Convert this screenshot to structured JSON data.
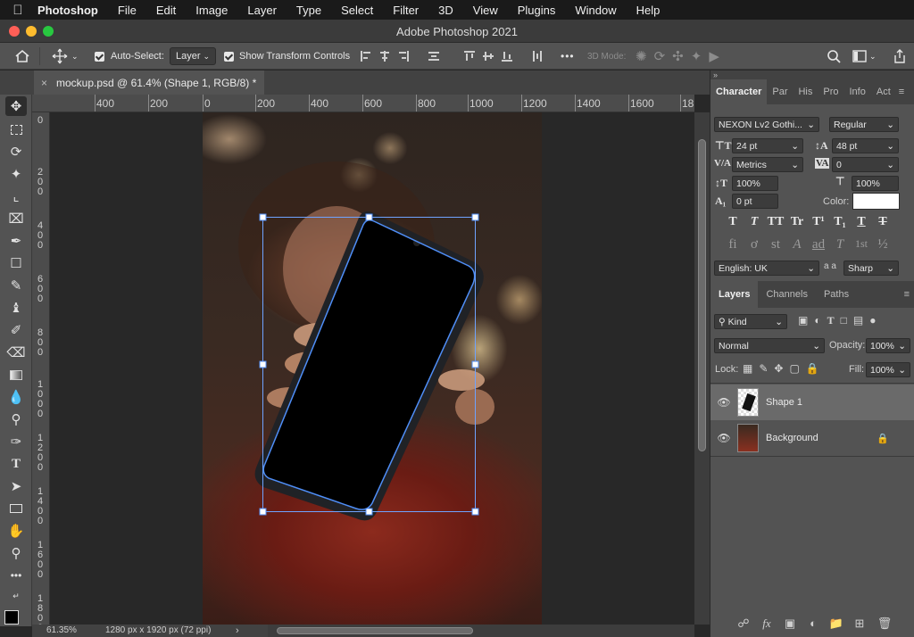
{
  "menubar": {
    "items": [
      "Photoshop",
      "File",
      "Edit",
      "Image",
      "Layer",
      "Type",
      "Select",
      "Filter",
      "3D",
      "View",
      "Plugins",
      "Window",
      "Help"
    ]
  },
  "window": {
    "title": "Adobe Photoshop 2021"
  },
  "options": {
    "auto_select_label": "Auto-Select:",
    "auto_select_target": "Layer",
    "show_transform_label": "Show Transform Controls",
    "mode_3d_label": "3D Mode:",
    "more": "•••"
  },
  "document": {
    "tab_title": "mockup.psd @ 61.4% (Shape 1, RGB/8) *"
  },
  "ruler": {
    "top_labels": [
      "400",
      "200",
      "0",
      "200",
      "400",
      "600",
      "800",
      "1000",
      "1200",
      "1400",
      "1600",
      "18"
    ],
    "left_labels": [
      "0",
      "2\n0\n0",
      "4\n0\n0",
      "6\n0\n0",
      "8\n0\n0",
      "1\n0\n0\n0",
      "1\n2\n0\n0",
      "1\n4\n0\n0",
      "1\n6\n0\n0",
      "1\n8\n0\n0"
    ]
  },
  "status": {
    "zoom": "61.35%",
    "doc_size": "1280 px x 1920 px (72 ppi)"
  },
  "character_panel": {
    "tabs": [
      "Character",
      "Par",
      "His",
      "Pro",
      "Info",
      "Act"
    ],
    "font_family": "NEXON Lv2 Gothi...",
    "font_style": "Regular",
    "font_size": "24 pt",
    "leading": "48 pt",
    "kerning": "Metrics",
    "tracking": "0",
    "vertical_scale": "100%",
    "horizontal_scale": "100%",
    "baseline_shift": "0 pt",
    "color_label": "Color:",
    "color_value": "#ffffff",
    "language": "English: UK",
    "antialias": "Sharp",
    "aa_label": "a a",
    "style_buttons": [
      "T",
      "T",
      "TT",
      "Tr",
      "T¹",
      "T₁",
      "T",
      "T"
    ],
    "opentype_buttons": [
      "fi",
      "ơ",
      "st",
      "A",
      "ad",
      "T",
      "1st",
      "½"
    ]
  },
  "layers_panel": {
    "tabs": [
      "Layers",
      "Channels",
      "Paths"
    ],
    "filter_kind": "Kind",
    "blend_mode": "Normal",
    "opacity_label": "Opacity:",
    "opacity_value": "100%",
    "lock_label": "Lock:",
    "fill_label": "Fill:",
    "fill_value": "100%",
    "layers": [
      {
        "name": "Shape 1",
        "selected": true
      },
      {
        "name": "Background",
        "selected": false,
        "locked": true
      }
    ],
    "footer_icons": [
      "link-icon",
      "fx-icon",
      "mask-icon",
      "adjustment-icon",
      "folder-icon",
      "new-layer-icon",
      "trash-icon"
    ],
    "fx_label": "fx"
  },
  "colors": {
    "accent": "#4f8ef7",
    "panel": "#535353",
    "canvas_bg": "#282828"
  }
}
